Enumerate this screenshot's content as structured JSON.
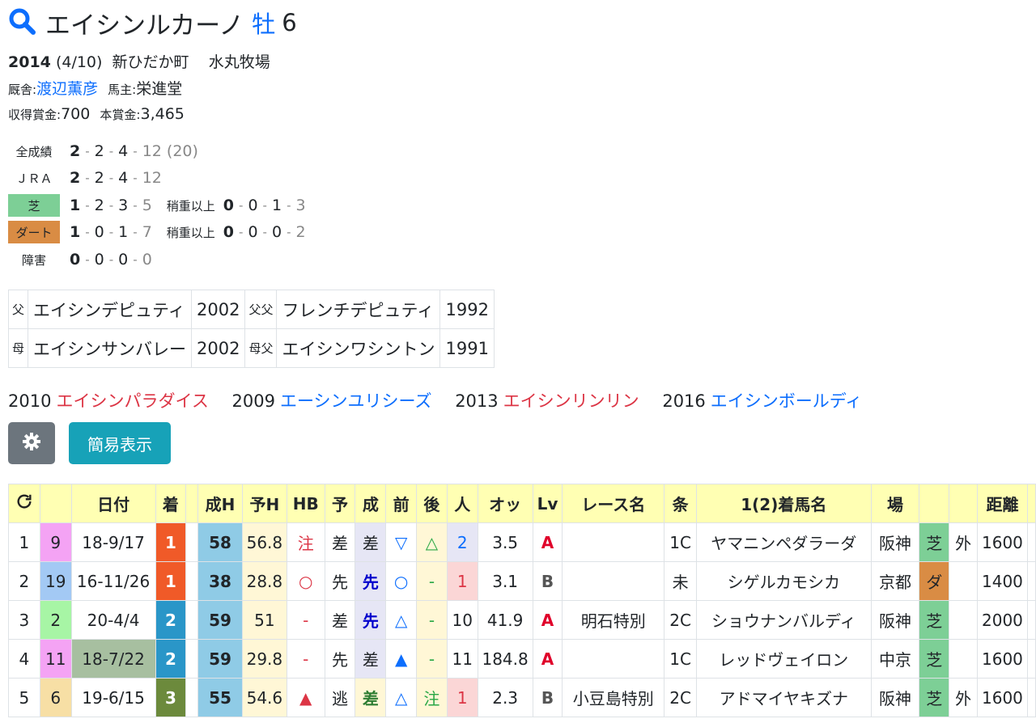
{
  "horse": {
    "name": "エイシンルカーノ",
    "sex": "牡",
    "age": "6"
  },
  "birth": {
    "year": "2014",
    "date": "(4/10)",
    "place": "新ひだか町",
    "breeder": "水丸牧場"
  },
  "trainer": {
    "label": "厩舎:",
    "name": "渡辺薫彦"
  },
  "owner": {
    "label": "馬主:",
    "name": "栄進堂"
  },
  "prize": {
    "earned_label": "収得賞金:",
    "earned": "700",
    "main_label": "本賞金:",
    "main": "3,465"
  },
  "records": {
    "all": {
      "label": "全成績",
      "a": "2",
      "b": "2",
      "c": "4",
      "d": "12",
      "total": "(20)"
    },
    "jra": {
      "label": "ＪＲＡ",
      "a": "2",
      "b": "2",
      "c": "4",
      "d": "12"
    },
    "turf": {
      "label": "芝",
      "a": "1",
      "b": "2",
      "c": "3",
      "d": "5",
      "sub_label": "稍重以上",
      "sa": "0",
      "sb": "0",
      "sc": "1",
      "sd": "3"
    },
    "dirt": {
      "label": "ダート",
      "a": "1",
      "b": "0",
      "c": "1",
      "d": "7",
      "sub_label": "稍重以上",
      "sa": "0",
      "sb": "0",
      "sc": "0",
      "sd": "2"
    },
    "jump": {
      "label": "障害",
      "a": "0",
      "b": "0",
      "c": "0",
      "d": "0"
    }
  },
  "pedigree": {
    "sire_label": "父",
    "sire": "エイシンデピュティ",
    "sire_year": "2002",
    "ss_label": "父父",
    "ss": "フレンチデピュティ",
    "ss_year": "1992",
    "dam_label": "母",
    "dam": "エイシンサンバレー",
    "dam_year": "2002",
    "ds_label": "母父",
    "ds": "エイシンワシントン",
    "ds_year": "1991"
  },
  "siblings": [
    {
      "year": "2010",
      "name": "エイシンパラダイス",
      "color": "#dc3545"
    },
    {
      "year": "2009",
      "name": "エーシンユリシーズ",
      "color": "#0d6efd"
    },
    {
      "year": "2013",
      "name": "エイシンリンリン",
      "color": "#dc3545"
    },
    {
      "year": "2016",
      "name": "エイシンボールディ",
      "color": "#0d6efd"
    }
  ],
  "buttons": {
    "settings_icon": "gear-icon",
    "simple": "簡易表示"
  },
  "table": {
    "headers": [
      "",
      "",
      "日付",
      "着",
      "",
      "成H",
      "予H",
      "HB",
      "予",
      "成",
      "前",
      "後",
      "人",
      "オッ",
      "Lv",
      "レース名",
      "条",
      "1(2)着馬名",
      "場",
      "",
      "",
      "距離",
      ""
    ],
    "rows": [
      {
        "no": "1",
        "gate": "9",
        "date": "18-9/17",
        "fin": "1",
        "h": "58",
        "yh": "56.8",
        "hb": "注",
        "yo": "差",
        "sei": "差",
        "mae": "▽",
        "ato": "△",
        "pop": "2",
        "odds": "3.5",
        "lv": "A",
        "race": "",
        "jo": "1C",
        "winner": "ヤマニンペダラーダ",
        "place": "阪神",
        "surf": "芝",
        "io": "外",
        "dist": "1600"
      },
      {
        "no": "2",
        "gate": "19",
        "date": "16-11/26",
        "fin": "1",
        "h": "38",
        "yh": "28.8",
        "hb": "○",
        "yo": "先",
        "sei": "先",
        "mae": "○",
        "ato": "-",
        "pop": "1",
        "odds": "3.1",
        "lv": "B",
        "race": "",
        "jo": "未",
        "winner": "シゲルカモシカ",
        "place": "京都",
        "surf": "ダ",
        "io": "",
        "dist": "1400"
      },
      {
        "no": "3",
        "gate": "2",
        "date": "20-4/4",
        "fin": "2",
        "h": "59",
        "yh": "51",
        "hb": "-",
        "yo": "差",
        "sei": "先",
        "mae": "△",
        "ato": "-",
        "pop": "10",
        "odds": "41.9",
        "lv": "A",
        "race": "明石特別",
        "jo": "2C",
        "winner": "ショウナンバルディ",
        "place": "阪神",
        "surf": "芝",
        "io": "",
        "dist": "2000"
      },
      {
        "no": "4",
        "gate": "11",
        "date": "18-7/22",
        "fin": "2",
        "h": "59",
        "yh": "29.8",
        "hb": "-",
        "yo": "先",
        "sei": "差",
        "mae": "▲",
        "ato": "-",
        "pop": "11",
        "odds": "184.8",
        "lv": "A",
        "race": "",
        "jo": "1C",
        "winner": "レッドヴェイロン",
        "place": "中京",
        "surf": "芝",
        "io": "",
        "dist": "1600"
      },
      {
        "no": "5",
        "gate": "6",
        "date": "19-6/15",
        "fin": "3",
        "h": "55",
        "yh": "54.6",
        "hb": "▲",
        "yo": "逃",
        "sei": "差",
        "mae": "△",
        "ato": "注",
        "pop": "1",
        "odds": "2.3",
        "lv": "B",
        "race": "小豆島特別",
        "jo": "2C",
        "winner": "アドマイヤキズナ",
        "place": "阪神",
        "surf": "芝",
        "io": "外",
        "dist": "1600"
      }
    ]
  }
}
